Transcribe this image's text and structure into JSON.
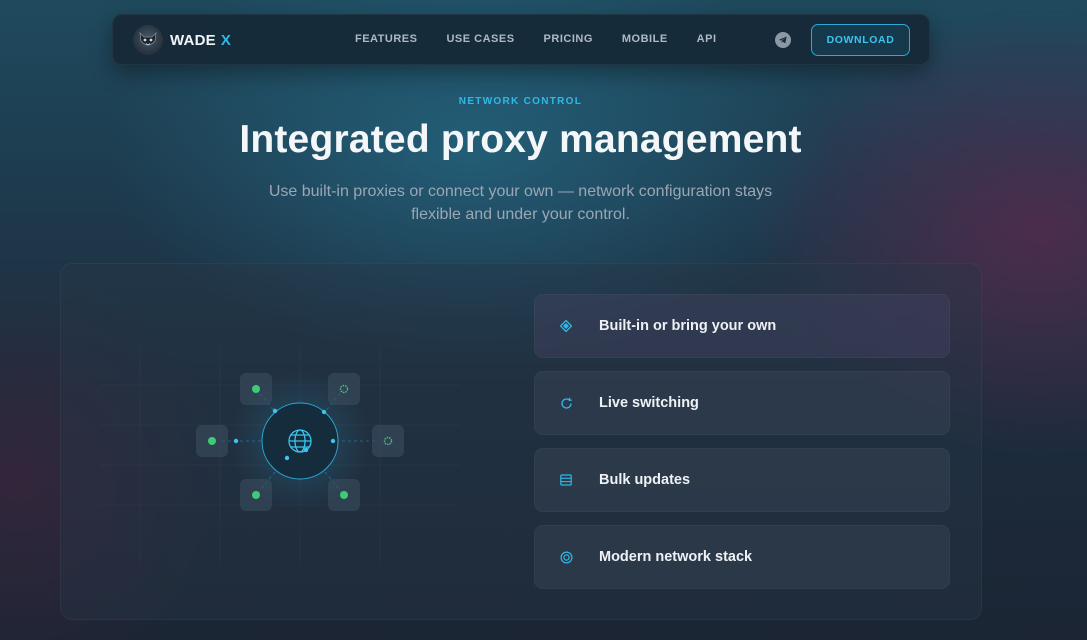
{
  "nav": {
    "brand": "WADE",
    "brand_accent": "X",
    "items": [
      {
        "label": "FEATURES"
      },
      {
        "label": "USE CASES"
      },
      {
        "label": "PRICING"
      },
      {
        "label": "MOBILE"
      },
      {
        "label": "API"
      }
    ],
    "telegram_icon": "telegram-icon",
    "download_label": "DOWNLOAD"
  },
  "hero": {
    "eyebrow": "NETWORK CONTROL",
    "title": "Integrated proxy management",
    "subtitle": "Use built-in proxies or connect your own — network configuration stays flexible and under your control."
  },
  "features": [
    {
      "label": "Built-in or bring your own",
      "icon": "diamond-icon"
    },
    {
      "label": "Live switching",
      "icon": "refresh-icon"
    },
    {
      "label": "Bulk updates",
      "icon": "list-icon"
    },
    {
      "label": "Modern network stack",
      "icon": "target-icon"
    }
  ],
  "colors": {
    "accent": "#2fb9e8",
    "node_green": "#3ecb78",
    "background_dark": "#1b2534"
  }
}
